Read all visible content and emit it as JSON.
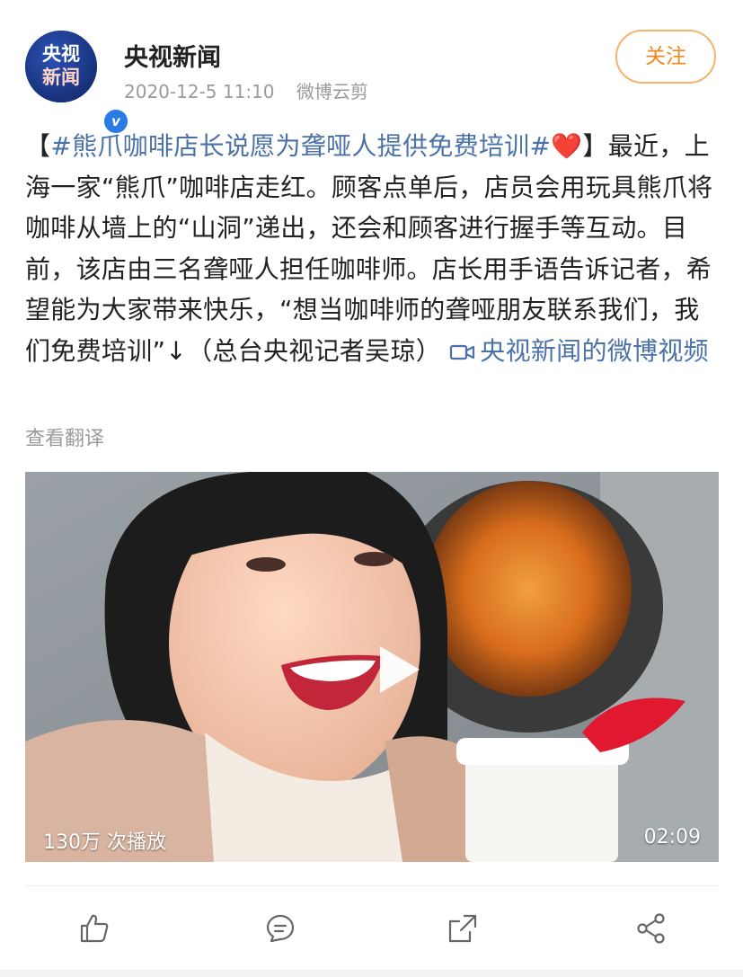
{
  "header": {
    "avatar_lines": [
      "央视",
      "新闻"
    ],
    "verified_mark": "v",
    "account_name": "央视新闻",
    "timestamp": "2020-12-5 11:10",
    "source": "微博云剪",
    "follow_label": "关注"
  },
  "post": {
    "open_bracket": "【",
    "hashtag": "#熊爪咖啡店长说愿为聋哑人提供免费培训#",
    "heart": "❤️",
    "body": "】最近，上海一家“熊爪”咖啡店走红。顾客点单后，店员会用玩具熊爪将咖啡从墙上的“山洞”递出，还会和顾客进行握手等互动。目前，该店由三名聋哑人担任咖啡师。店长用手语告诉记者，希望能为大家带来快乐，“想当咖啡师的聋哑朋友联系我们，我们免费培训”↓（总台央视记者吴琼）",
    "video_link_label": "央视新闻的微博视频",
    "translate_label": "查看翻译"
  },
  "video": {
    "views": "130万 次播放",
    "duration": "02:09"
  },
  "actions": {
    "like_icon": "thumbs-up-icon",
    "comment_icon": "comment-icon",
    "repost_icon": "repost-icon",
    "share_icon": "share-icon"
  },
  "colors": {
    "link": "#4a72a8",
    "follow": "#f08a1c",
    "muted": "#9a9a9a"
  }
}
